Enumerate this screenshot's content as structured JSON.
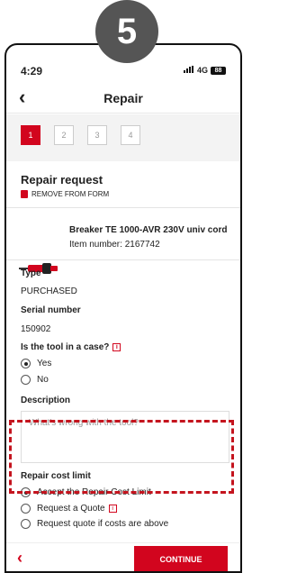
{
  "step_badge": "5",
  "status": {
    "time": "4:29",
    "network": "4G",
    "battery": "88"
  },
  "nav": {
    "back_glyph": "‹",
    "title": "Repair"
  },
  "steps": [
    "1",
    "2",
    "3",
    "4"
  ],
  "repair_request": {
    "title": "Repair request",
    "remove_label": "REMOVE FROM FORM"
  },
  "product": {
    "name": "Breaker TE 1000-AVR 230V univ cord",
    "item_number_label": "Item number:",
    "item_number": "2167742"
  },
  "type": {
    "label": "Type",
    "value": "PURCHASED"
  },
  "serial": {
    "label": "Serial number",
    "value": "150902"
  },
  "case_question": {
    "label": "Is the tool in a case?",
    "options": [
      "Yes",
      "No"
    ],
    "selected": "Yes"
  },
  "description": {
    "label": "Description",
    "placeholder": "What's wrong with the tool?"
  },
  "repair_cost": {
    "label": "Repair cost limit",
    "options": [
      "Accept the Repair Cost Limit",
      "Request a Quote",
      "Request quote if costs are above"
    ],
    "selected": "Accept the Repair Cost Limit"
  },
  "footer": {
    "back_glyph": "‹",
    "continue_label": "CONTINUE"
  },
  "colors": {
    "accent": "#d2051e",
    "annotation": "#c4141e"
  }
}
